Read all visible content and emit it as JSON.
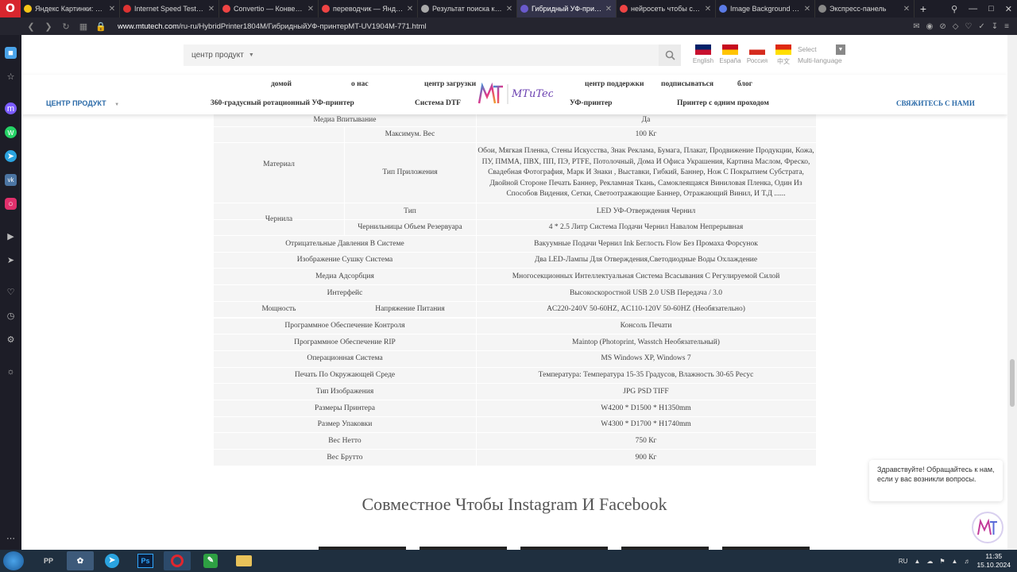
{
  "browser": {
    "tabs": [
      {
        "title": "Яндекс Картинки: поиск",
        "color": "#f5c518"
      },
      {
        "title": "Internet Speed Test | Fas",
        "color": "#d33"
      },
      {
        "title": "Convertio — Конвертер",
        "color": "#e44"
      },
      {
        "title": "переводчик — Яндекс:",
        "color": "#e44"
      },
      {
        "title": "Результат поиска карти",
        "color": "#aaa"
      },
      {
        "title": "Гибридный УФ-принтер",
        "color": "#6a5acd"
      },
      {
        "title": "нейросеть чтобы сдела",
        "color": "#e44"
      },
      {
        "title": "Image Background Remo",
        "color": "#5b7be6"
      },
      {
        "title": "Экспресс-панель",
        "color": "#888"
      }
    ],
    "url_domain": "www.mtutech.com",
    "url_path": "/ru-ru/HybridPrinter1804M/ГибридныйУФ-принтерMT-UV1904M-771.html"
  },
  "site": {
    "product_select": "центр продукт",
    "languages": [
      {
        "label": "English",
        "c1": "#012169",
        "c2": "#c8102e"
      },
      {
        "label": "España",
        "c1": "#c60b1e",
        "c2": "#ffc400"
      },
      {
        "label": "Россия",
        "c1": "#ffffff",
        "c2": "#d52b1e"
      },
      {
        "label": "中文",
        "c1": "#de2910",
        "c2": "#ffde00"
      }
    ],
    "multi_select": "Select",
    "multi_label": "Multi-language",
    "nav_top": [
      "домой",
      "о нас",
      "центр загрузки",
      "центр поддержки",
      "подписываться",
      "блог"
    ],
    "nav_bottom": [
      "360-градусный ротационный УФ-принтер",
      "Система DTF",
      "УФ-принтер",
      "Принтер с одним проходом"
    ],
    "nav_product": "ЦЕНТР ПРОДУКТ",
    "nav_contact": "СВЯЖИТЕСЬ С НАМИ",
    "logo_text": "MTuTech"
  },
  "specs": {
    "media_absorb_label": "Медиа Впитывание",
    "media_absorb_value": "Да",
    "material_label": "Материал",
    "max_weight_label": "Максимум. Вес",
    "max_weight_value": "100 Кг",
    "app_type_label": "Тип Приложения",
    "app_type_value": "Обои, Мягкая Пленка, Стены Искусства, Знак Реклама, Бумага, Плакат, Продвижение Продукции, Кожа, ПУ, ПММА, ПВХ, ПП, ПЭ, PTFE, Потолочный, Дома И Офиса Украшения, Картина Маслом, Фреско, Свадебная Фотография, Марк И Знаки , Выставки, Гибкий, Баннер, Нож С Покрытием Субстрата, Двойной Стороне Печать Баннер, Рекламная Ткань, Самоклеящаяся Виниловая Пленка, Один Из Способов Видения, Сетки, Светоотражающие Баннер, Отражающий Винил, И Т.Д ......",
    "ink_label": "Чернила",
    "ink_type_label": "Тип",
    "ink_type_value": "LED УФ-Отверждения Чернил",
    "ink_volume_label": "Чернильницы Объем Резервуара",
    "ink_volume_value": "4 * 2.5 Литр Система Подачи Чернил Навалом Непрерывная",
    "rows": [
      {
        "label": "Отрицательные Давления В Системе",
        "value": "Вакуумные Подачи Чернил Ink Беглость Flow Без Промаха Форсунок"
      },
      {
        "label": "Изображение Сушку Система",
        "value": "Два LED-Лампы Для Отверждения,Светодиодные Воды Охлаждение"
      },
      {
        "label": "Медиа Адсорбция",
        "value": "Многосекционных Интеллектуальная Система Всасывания С Регулируемой Силой"
      },
      {
        "label": "Интерфейс",
        "value": "Высокоскоростной USB 2.0 USB Передача / 3.0"
      }
    ],
    "power_label": "Мощность",
    "power_sub": "Напряжение Питания",
    "power_value": "AC220-240V 50-60HZ, AC110-120V 50-60HZ (Необязательно)",
    "rows2": [
      {
        "label": "Программное Обеспечение Контроля",
        "value": "Консоль Печати"
      },
      {
        "label": "Программное Обеспечение RIP",
        "value": "Maintop (Photoprint, Wasstch Необязательный)"
      },
      {
        "label": "Операционная Система",
        "value": "MS Windows XP, Windows 7"
      },
      {
        "label": "Печать По Окружающей Среде",
        "value": "Температура: Температура 15-35 Градусов, Влажность 30-65 Ресус"
      },
      {
        "label": "Тип Изображения",
        "value": "JPG PSD TIFF"
      },
      {
        "label": "Размеры Принтера",
        "value": "W4200 * D1500 * H1350mm"
      },
      {
        "label": "Размер Упаковки",
        "value": "W4300 * D1700 * H1740mm"
      },
      {
        "label": "Вес Нетто",
        "value": "750 Кг"
      },
      {
        "label": "Вес Брутто",
        "value": "900 Кг"
      }
    ]
  },
  "social_title": "Совместное Чтобы Instagram И Facebook",
  "chat_message": "Здравствуйте! Обращайтесь к нам, если у вас возникли вопросы.",
  "taskbar": {
    "apps": [
      "PP",
      "",
      "",
      "Ps",
      "",
      "",
      ""
    ],
    "lang": "RU",
    "time": "11:35",
    "date": "15.10.2024"
  }
}
